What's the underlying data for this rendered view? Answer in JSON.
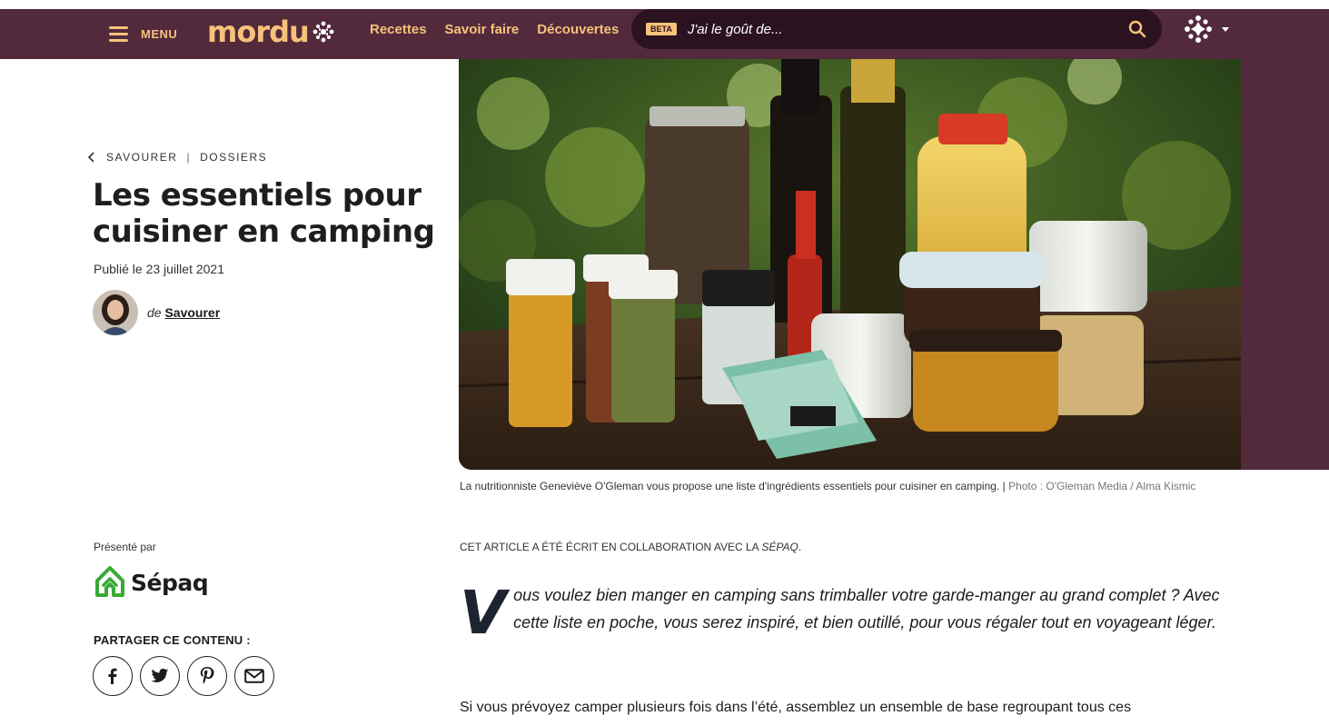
{
  "header": {
    "menu_label": "MENU",
    "logo_text": "mordu",
    "nav": [
      "Recettes",
      "Savoir faire",
      "Découvertes"
    ],
    "search": {
      "badge": "BETA",
      "placeholder": "J'ai le goût de..."
    }
  },
  "hero": {
    "caption": "La nutritionniste Geneviève O'Gleman vous propose une liste d'ingrédients essentiels pour cuisiner en camping.",
    "credit": "Photo : O'Gleman Media / Alma Kismic"
  },
  "article": {
    "breadcrumb": [
      "SAVOURER",
      "DOSSIERS"
    ],
    "title": "Les essentiels pour cuisiner en camping",
    "published": "Publié le 23 juillet 2021",
    "author_prefix": "de",
    "author": "Savourer",
    "collab_prefix": "CET ARTICLE A ÉTÉ ÉCRIT EN COLLABORATION AVEC LA",
    "collab_partner": "SÉPAQ",
    "dropcap": "V",
    "lead": "ous voulez bien manger en camping sans trimballer votre garde-manger au grand complet ? Avec cette liste en poche, vous serez inspiré, et bien outillé, pour vous régaler tout en voyageant léger.",
    "paragraph": "Si vous prévoyez camper plusieurs fois dans l’été, assemblez un ensemble de base regroupant tous ces"
  },
  "sponsor": {
    "label": "Présenté par",
    "name": "Sépaq"
  },
  "share": {
    "label": "PARTAGER CE CONTENU :",
    "buttons": [
      "facebook-icon",
      "twitter-icon",
      "pinterest-icon",
      "email-icon"
    ]
  },
  "colors": {
    "header_bg": "#522a3c",
    "accent": "#f7c27a",
    "search_bg": "#2a1220",
    "sepaq_green": "#3aaa35"
  }
}
